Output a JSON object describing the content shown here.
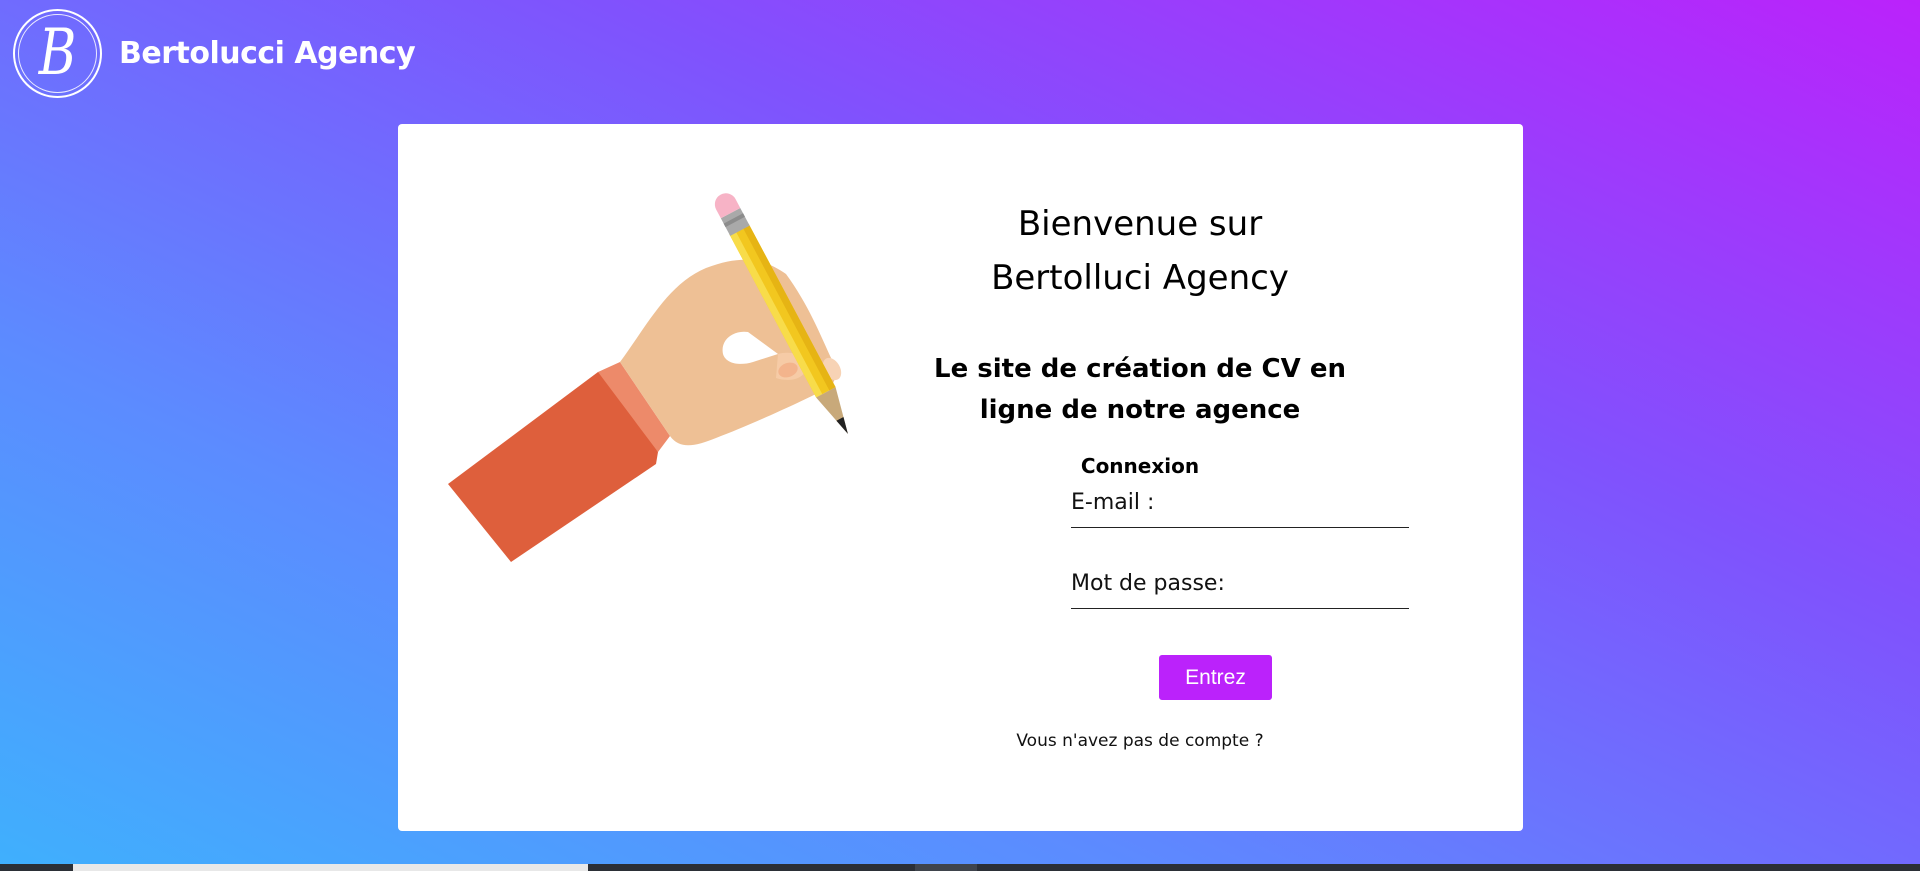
{
  "header": {
    "logo_letter": "B",
    "brand_name": "Bertolucci Agency"
  },
  "login": {
    "welcome_line1": "Bienvenue sur",
    "welcome_line2": "Bertolluci Agency",
    "subtitle": "Le site de création de CV en ligne de notre agence",
    "section_title": "Connexion",
    "email_label": "E-mail :",
    "email_value": "",
    "password_label": "Mot de passe:",
    "password_value": "",
    "submit_label": "Entrez",
    "register_link": "Vous n'avez pas de compte ?"
  },
  "colors": {
    "accent": "#bb22fb",
    "gradient_start": "#3fb0fd",
    "gradient_end": "#bb22fb",
    "card_background": "#ffffff"
  },
  "icons": {
    "logo": "b-monogram-logo",
    "illustration": "hand-writing-with-pencil"
  }
}
